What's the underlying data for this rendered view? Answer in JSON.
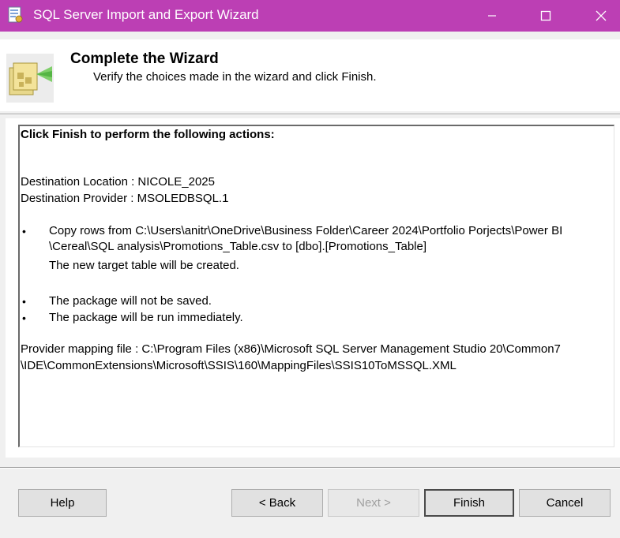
{
  "window": {
    "title": "SQL Server Import and Export Wizard",
    "icons": {
      "app": "sql-wizard-app-icon",
      "minimize": "minimize-icon",
      "maximize": "maximize-icon",
      "close": "close-icon"
    }
  },
  "header": {
    "title": "Complete the Wizard",
    "subtitle": "Verify the choices made in the wizard and click Finish.",
    "icon": "wizard-complete-icon"
  },
  "summary": {
    "heading": "Click Finish to perform the following actions:",
    "destination_location": "Destination Location : NICOLE_2025",
    "destination_provider": "Destination Provider : MSOLEDBSQL.1",
    "bullet_symbol": "•",
    "copy_rows_line1": "Copy rows from C:\\Users\\anitr\\OneDrive\\Business Folder\\Career 2024\\Portfolio Porjects\\Power BI",
    "copy_rows_line2": "\\Cereal\\SQL analysis\\Promotions_Table.csv to [dbo].[Promotions_Table]",
    "new_table_note": "The new target table will be created.",
    "package_not_saved": "The package will not be saved.",
    "package_run": "The package will be run immediately.",
    "mapping_line1": "Provider mapping file : C:\\Program Files (x86)\\Microsoft SQL Server Management Studio 20\\Common7",
    "mapping_line2": "\\IDE\\CommonExtensions\\Microsoft\\SSIS\\160\\MappingFiles\\SSIS10ToMSSQL.XML"
  },
  "buttons": {
    "help": "Help",
    "back": "< Back",
    "next": "Next >",
    "finish": "Finish",
    "cancel": "Cancel"
  },
  "colors": {
    "titlebar": "#bc3fb4",
    "client": "#f0f0f0"
  }
}
